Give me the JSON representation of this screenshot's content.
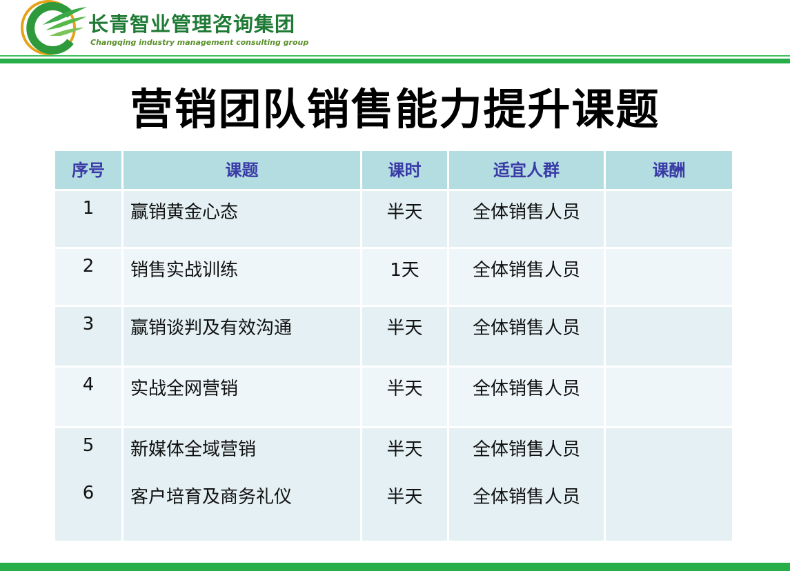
{
  "brand": {
    "name_cn": "长青智业管理咨询集团",
    "name_en": "Changqing industry management consulting group"
  },
  "title": "营销团队销售能力提升课题",
  "table": {
    "headers": [
      "序号",
      "课题",
      "课时",
      "适宜人群",
      "课酬"
    ],
    "rows": [
      {
        "no": "1",
        "topic": "赢销黄金心态",
        "duration": "半天",
        "audience": "全体销售人员",
        "fee": ""
      },
      {
        "no": "2",
        "topic": "销售实战训练",
        "duration": "1天",
        "audience": "全体销售人员",
        "fee": ""
      },
      {
        "no": "3",
        "topic": "赢销谈判及有效沟通",
        "duration": "半天",
        "audience": "全体销售人员",
        "fee": ""
      },
      {
        "no": "4",
        "topic": "实战全网营销",
        "duration": "半天",
        "audience": "全体销售人员",
        "fee": ""
      },
      {
        "no": "5",
        "topic": "新媒体全域营销",
        "duration": "半天",
        "audience": "全体销售人员",
        "fee": ""
      },
      {
        "no": "6",
        "topic": "客户培育及商务礼仪",
        "duration": "半天",
        "audience": "全体销售人员",
        "fee": ""
      }
    ]
  },
  "colors": {
    "brand_green": "#27ae48",
    "header_bg": "#b4dde2",
    "header_text": "#3a3aa6",
    "row_bg_a": "#e4f0f3",
    "row_bg_b": "#eff6f9"
  }
}
